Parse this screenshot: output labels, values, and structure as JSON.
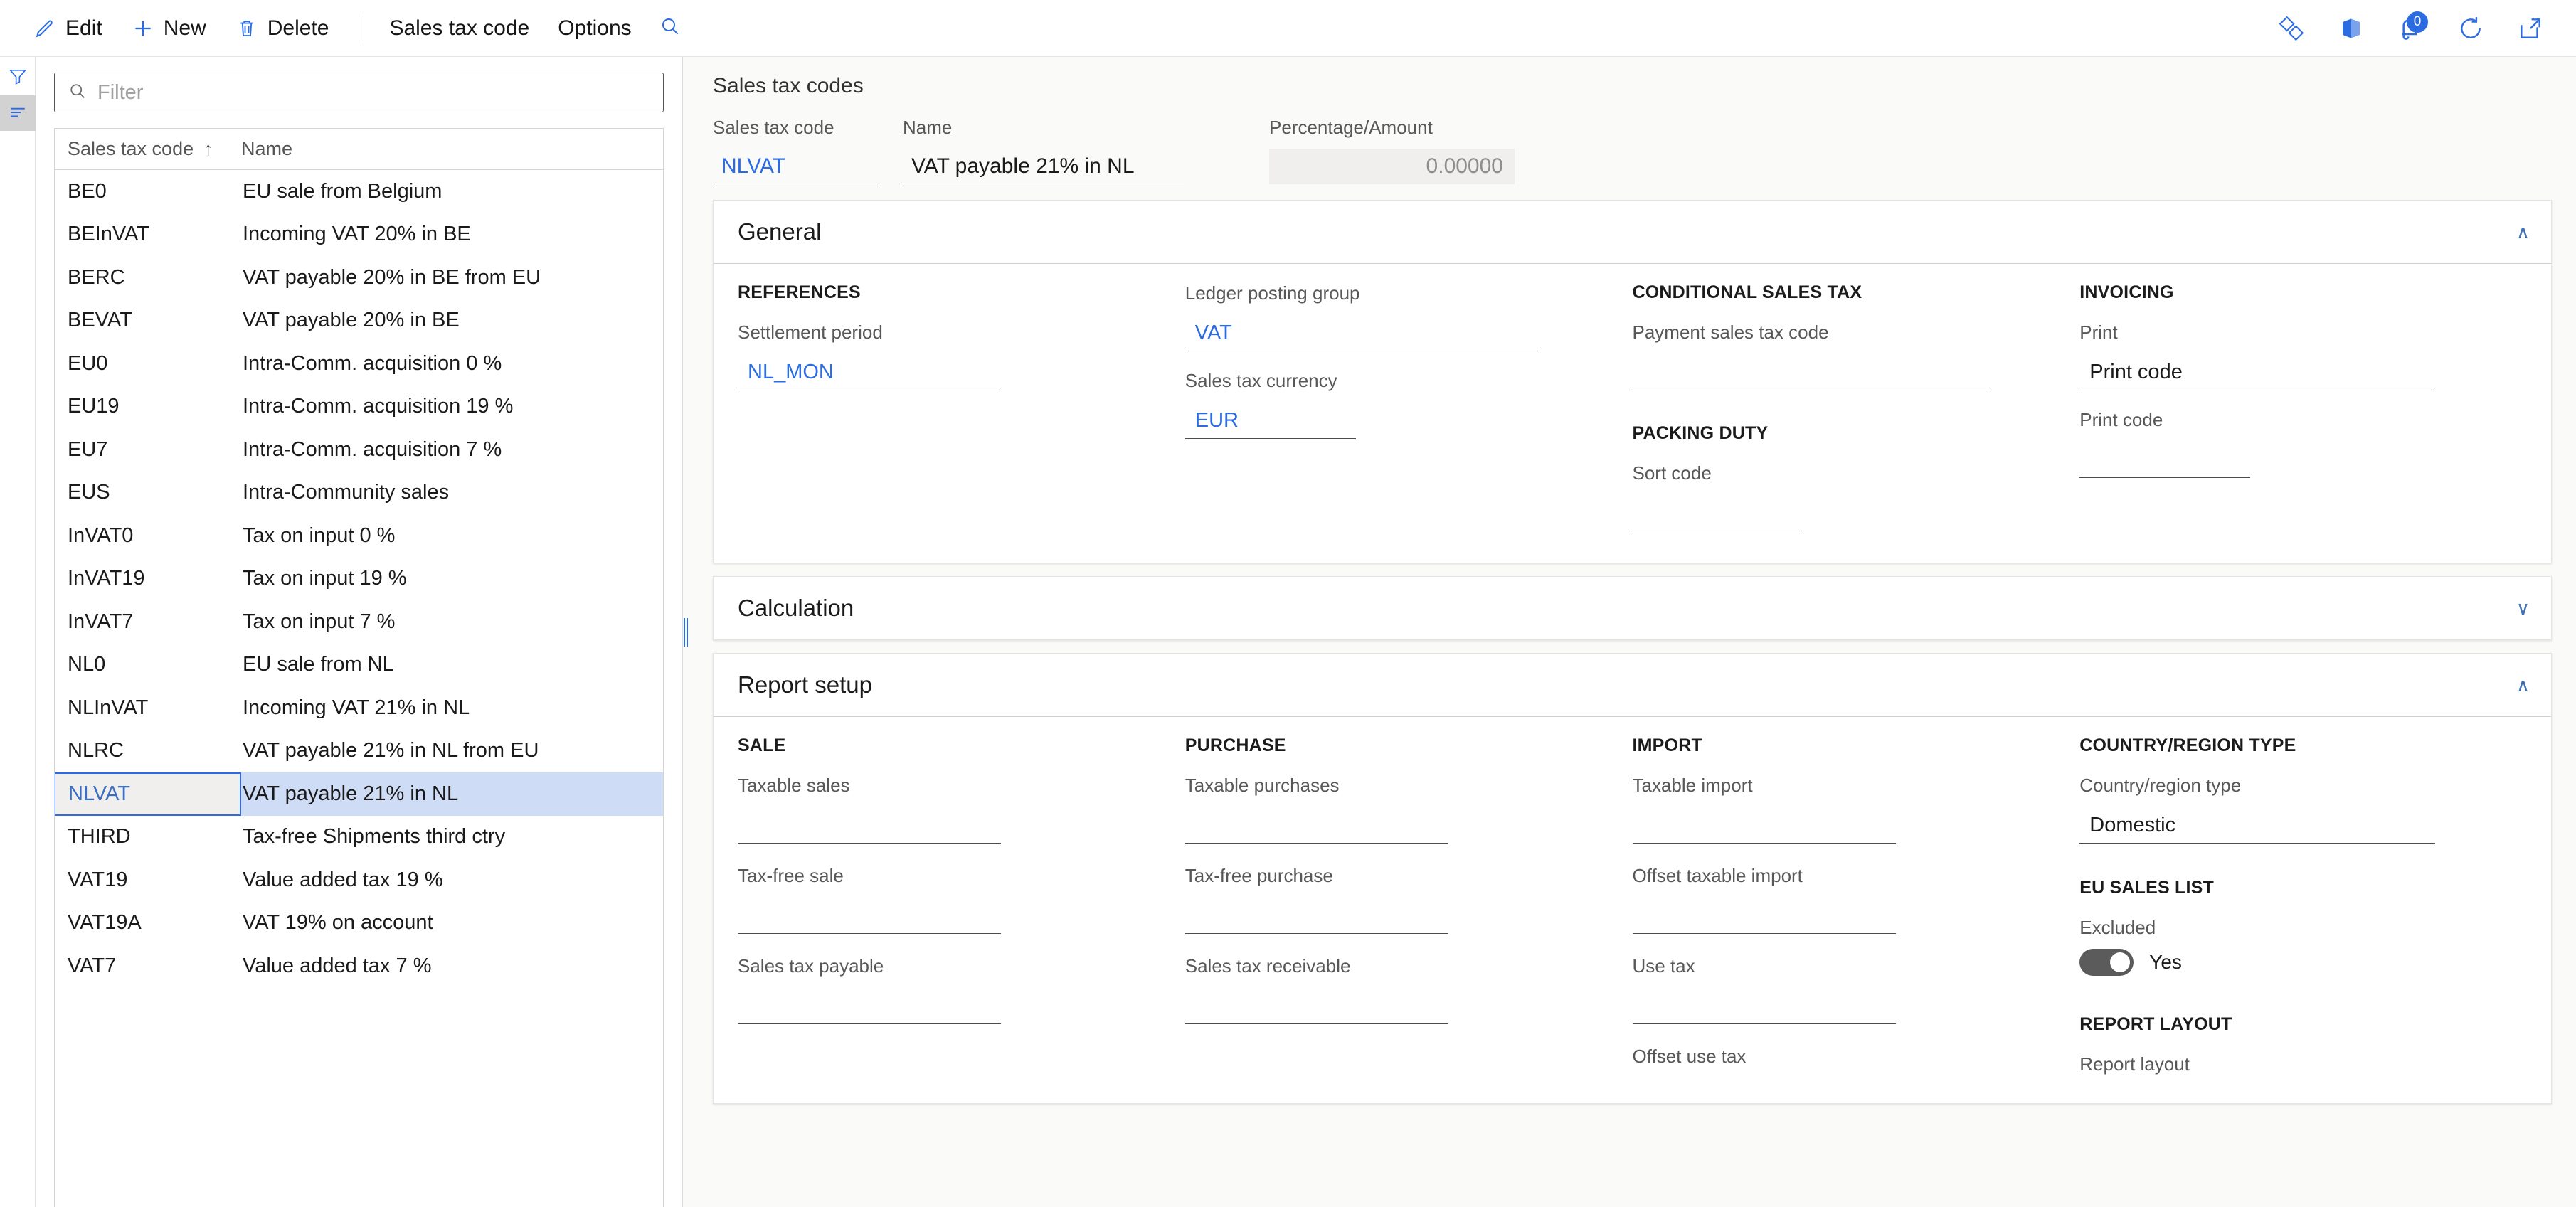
{
  "commandbar": {
    "items": [
      {
        "label": "Edit",
        "icon": "pencil-icon"
      },
      {
        "label": "New",
        "icon": "plus-icon"
      },
      {
        "label": "Delete",
        "icon": "trash-icon"
      }
    ],
    "menus": [
      {
        "label": "Sales tax code"
      },
      {
        "label": "Options"
      }
    ],
    "search_icon": "search-icon",
    "right_icons": [
      {
        "name": "dynamics-logo-icon"
      },
      {
        "name": "office-apps-icon"
      },
      {
        "name": "notifications-icon",
        "badge": "0"
      },
      {
        "name": "refresh-icon"
      },
      {
        "name": "open-in-new-window-icon"
      }
    ]
  },
  "rail": {
    "items": [
      {
        "name": "filter-pane-icon",
        "active": false
      },
      {
        "name": "list-pane-icon",
        "active": true
      }
    ]
  },
  "list": {
    "filter_placeholder": "Filter",
    "filter_value": "",
    "columns": [
      "Sales tax code",
      "Name"
    ],
    "sort_column": "Sales tax code",
    "sort_direction": "ascending",
    "sort_glyph": "↑",
    "selected_code": "NLVAT",
    "rows": [
      {
        "code": "BE0",
        "name": "EU sale from Belgium"
      },
      {
        "code": "BEInVAT",
        "name": "Incoming VAT 20% in BE"
      },
      {
        "code": "BERC",
        "name": "VAT payable 20% in BE from EU"
      },
      {
        "code": "BEVAT",
        "name": "VAT payable 20% in BE"
      },
      {
        "code": "EU0",
        "name": "Intra-Comm. acquisition 0 %"
      },
      {
        "code": "EU19",
        "name": "Intra-Comm. acquisition 19 %"
      },
      {
        "code": "EU7",
        "name": "Intra-Comm. acquisition 7 %"
      },
      {
        "code": "EUS",
        "name": "Intra-Community sales"
      },
      {
        "code": "InVAT0",
        "name": "Tax on input 0 %"
      },
      {
        "code": "InVAT19",
        "name": "Tax on input 19 %"
      },
      {
        "code": "InVAT7",
        "name": "Tax on input 7 %"
      },
      {
        "code": "NL0",
        "name": "EU sale from NL"
      },
      {
        "code": "NLInVAT",
        "name": "Incoming VAT 21% in NL"
      },
      {
        "code": "NLRC",
        "name": "VAT payable 21% in NL from EU"
      },
      {
        "code": "NLVAT",
        "name": "VAT payable 21% in NL"
      },
      {
        "code": "THIRD",
        "name": "Tax-free Shipments third ctry"
      },
      {
        "code": "VAT19",
        "name": "Value added tax 19 %"
      },
      {
        "code": "VAT19A",
        "name": "VAT 19% on account"
      },
      {
        "code": "VAT7",
        "name": "Value added tax 7 %"
      }
    ]
  },
  "detail": {
    "page_title": "Sales tax codes",
    "header_fields": {
      "code": {
        "label": "Sales tax code",
        "value": "NLVAT"
      },
      "name": {
        "label": "Name",
        "value": "VAT payable 21% in NL"
      },
      "percentage": {
        "label": "Percentage/Amount",
        "value": "0.00000"
      }
    },
    "sections": [
      {
        "id": "general",
        "title": "General",
        "expanded": true,
        "chevron": "∧",
        "columns": [
          {
            "group": "REFERENCES",
            "fields": [
              {
                "label": "Settlement period",
                "value": "NL_MON",
                "style": "link",
                "width": "w-long"
              }
            ]
          },
          {
            "group": "",
            "fields": [
              {
                "label": "Ledger posting group",
                "value": "VAT",
                "style": "link",
                "width": "w-xl"
              },
              {
                "label": "Sales tax currency",
                "value": "EUR",
                "style": "link",
                "width": "w-med"
              }
            ]
          },
          {
            "group": "CONDITIONAL SALES TAX",
            "fields": [
              {
                "label": "Payment sales tax code",
                "value": "",
                "style": "plain",
                "width": "w-xl"
              }
            ],
            "group2": "PACKING DUTY",
            "fields2": [
              {
                "label": "Sort code",
                "value": "",
                "style": "plain",
                "width": "w-med"
              }
            ]
          },
          {
            "group": "INVOICING",
            "fields": [
              {
                "label": "Print",
                "value": "Print code",
                "style": "plain",
                "width": "w-xl"
              },
              {
                "label": "Print code",
                "value": "",
                "style": "plain",
                "width": "w-med"
              }
            ]
          }
        ]
      },
      {
        "id": "calculation",
        "title": "Calculation",
        "expanded": false,
        "chevron": "∨"
      },
      {
        "id": "report-setup",
        "title": "Report setup",
        "expanded": true,
        "chevron": "∧",
        "columns": [
          {
            "group": "SALE",
            "fields": [
              {
                "label": "Taxable sales",
                "value": "",
                "style": "plain",
                "width": "w-long"
              },
              {
                "label": "Tax-free sale",
                "value": "",
                "style": "plain",
                "width": "w-long"
              },
              {
                "label": "Sales tax payable",
                "value": "",
                "style": "plain",
                "width": "w-long"
              }
            ]
          },
          {
            "group": "PURCHASE",
            "fields": [
              {
                "label": "Taxable purchases",
                "value": "",
                "style": "plain",
                "width": "w-long"
              },
              {
                "label": "Tax-free purchase",
                "value": "",
                "style": "plain",
                "width": "w-long"
              },
              {
                "label": "Sales tax receivable",
                "value": "",
                "style": "plain",
                "width": "w-long"
              }
            ]
          },
          {
            "group": "IMPORT",
            "fields": [
              {
                "label": "Taxable import",
                "value": "",
                "style": "plain",
                "width": "w-long"
              },
              {
                "label": "Offset taxable import",
                "value": "",
                "style": "plain",
                "width": "w-long"
              },
              {
                "label": "Use tax",
                "value": "",
                "style": "plain",
                "width": "w-long"
              },
              {
                "label": "Offset use tax",
                "value": "",
                "style": "plain",
                "width": "w-long"
              }
            ]
          },
          {
            "group": "COUNTRY/REGION TYPE",
            "fields": [
              {
                "label": "Country/region type",
                "value": "Domestic",
                "style": "plain",
                "width": "w-xl"
              }
            ],
            "group2": "EU SALES LIST",
            "toggle": {
              "label": "Excluded",
              "state_label": "Yes",
              "on": true
            },
            "group3": "REPORT LAYOUT",
            "cut_label": "Report layout"
          }
        ]
      }
    ]
  },
  "colors": {
    "accent": "#2b6ce3",
    "link": "#2b6ce3",
    "selection": "#cfdcf5",
    "page_bg": "#fafaf9"
  }
}
